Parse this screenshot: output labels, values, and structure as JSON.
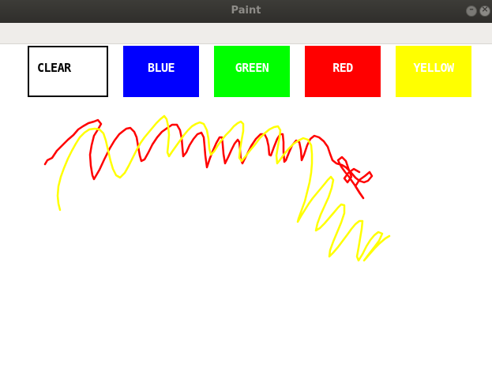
{
  "window": {
    "title": "Paint",
    "minimize_glyph": "–",
    "close_glyph": "×"
  },
  "toolbar": {
    "buttons": [
      {
        "id": "clear",
        "label": "CLEAR",
        "color": "#ffffff"
      },
      {
        "id": "blue",
        "label": "BLUE",
        "color": "#0000ff"
      },
      {
        "id": "green",
        "label": "GREEN",
        "color": "#00ff00"
      },
      {
        "id": "red",
        "label": "RED",
        "color": "#ff0000"
      },
      {
        "id": "yellow",
        "label": "YELLOW",
        "color": "#ffff00"
      }
    ]
  },
  "canvas": {
    "strokes": [
      {
        "color": "#ff0000",
        "name": "red-stroke"
      },
      {
        "color": "#ffff00",
        "name": "yellow-stroke"
      }
    ]
  }
}
